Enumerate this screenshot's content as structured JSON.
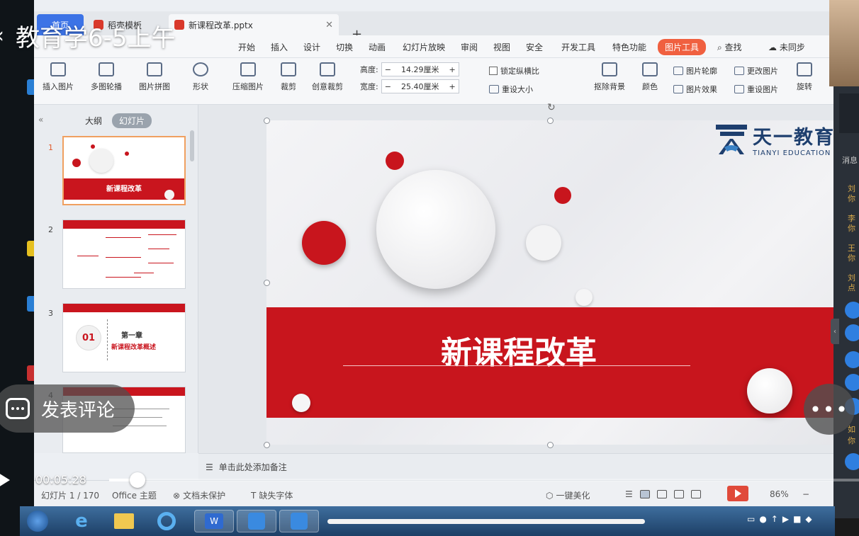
{
  "video": {
    "title": "教育学6-5上午",
    "comment_placeholder": "发表评论",
    "current_time": "00:05:28",
    "progress": 0.038
  },
  "wps": {
    "tabs": [
      {
        "label": "首页"
      },
      {
        "label": "稻壳模板"
      },
      {
        "label": "新课程改革.pptx"
      }
    ],
    "menu": [
      "开始",
      "插入",
      "设计",
      "切换",
      "动画",
      "幻灯片放映",
      "审阅",
      "视图",
      "安全",
      "开发工具",
      "特色功能",
      "图片工具",
      "查找",
      "未同步"
    ],
    "ribbon": {
      "buttons": [
        "插入图片",
        "多图轮播",
        "图片拼图",
        "形状",
        "压缩图片",
        "裁剪",
        "创意裁剪"
      ],
      "height_label": "高度:",
      "height_value": "14.29厘米",
      "width_label": "宽度:",
      "width_value": "25.40厘米",
      "lock_ratio": "锁定纵横比",
      "reset_size": "重设大小",
      "right_buttons": [
        "抠除背景",
        "颜色",
        "图片轮廓",
        "图片效果",
        "更改图片",
        "重设图片",
        "旋转"
      ]
    },
    "sidebar": {
      "outline_tab": "大纲",
      "slides_tab": "幻灯片",
      "thumbs": [
        {
          "num": "1",
          "title": "新课程改革"
        },
        {
          "num": "2"
        },
        {
          "num": "3",
          "chapter_num": "01",
          "chapter": "第一章",
          "chapter_sub": "新课程改革概述"
        },
        {
          "num": "4"
        }
      ]
    },
    "slide": {
      "title": "新课程改革",
      "logo_cn": "天一教育",
      "logo_en": "TIANYI EDUCATION"
    },
    "notes_placeholder": "单击此处添加备注",
    "status": {
      "slide_info": "幻灯片 1 / 170",
      "theme": "Office 主题",
      "doc_protect": "文档未保护",
      "missing_font": "缺失字体",
      "beautify": "一键美化",
      "zoom": "86%"
    }
  },
  "chat": {
    "header": "消息",
    "names": [
      "刘",
      "你",
      "李",
      "你",
      "王",
      "你",
      "刘",
      "点",
      "如",
      "你"
    ]
  },
  "colors": {
    "accent_red": "#c8151d",
    "wps_blue": "#3c73e6",
    "tool_orange": "#f06040"
  }
}
